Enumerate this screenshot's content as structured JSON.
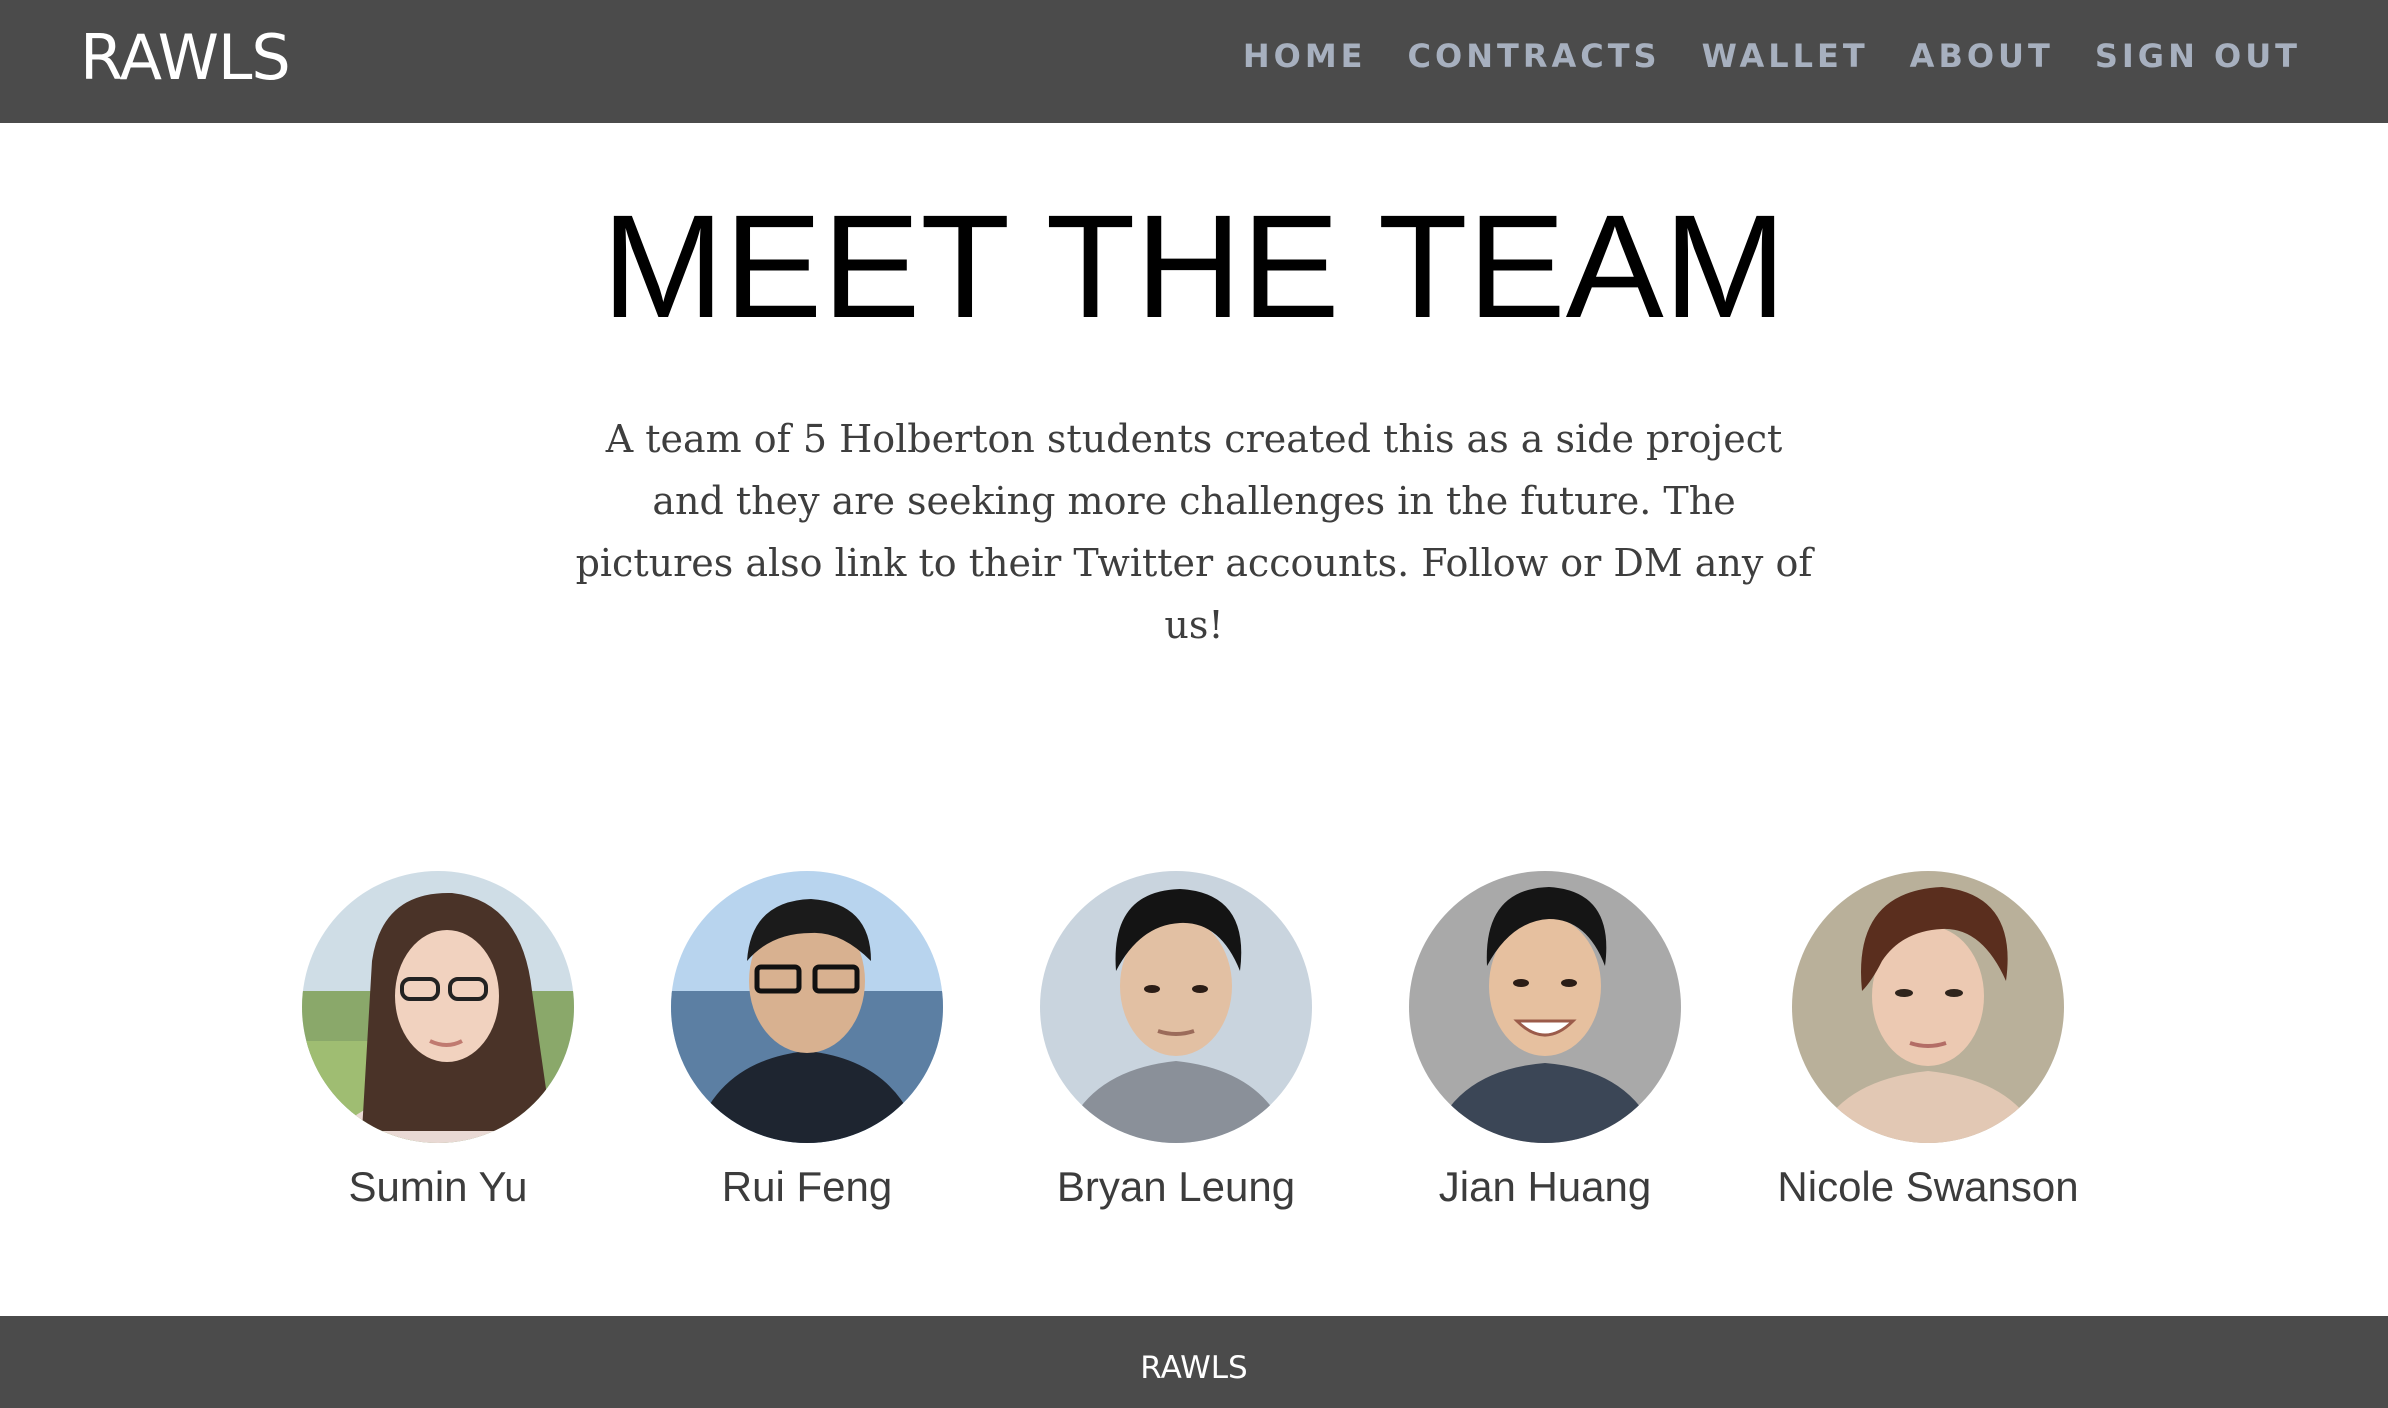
{
  "header": {
    "brand": "RAWLS",
    "nav": [
      {
        "label": "HOME"
      },
      {
        "label": "CONTRACTS"
      },
      {
        "label": "WALLET"
      },
      {
        "label": "ABOUT"
      },
      {
        "label": "SIGN OUT"
      }
    ]
  },
  "main": {
    "title": "MEET THE TEAM",
    "intro": "A team of 5 Holberton students created this as a side project and they are seeking more challenges in the future. The pictures also link to their Twitter accounts. Follow or DM any of us!",
    "team": [
      {
        "name": "Sumin Yu"
      },
      {
        "name": "Rui Feng"
      },
      {
        "name": "Bryan Leung"
      },
      {
        "name": "Jian Huang"
      },
      {
        "name": "Nicole Swanson"
      }
    ]
  },
  "footer": {
    "text": "RAWLS"
  },
  "colors": {
    "navbar": "#4b4b4b",
    "nav_link": "#a7b0bf",
    "brand": "#ffffff",
    "body_text": "#3e3e3e"
  }
}
